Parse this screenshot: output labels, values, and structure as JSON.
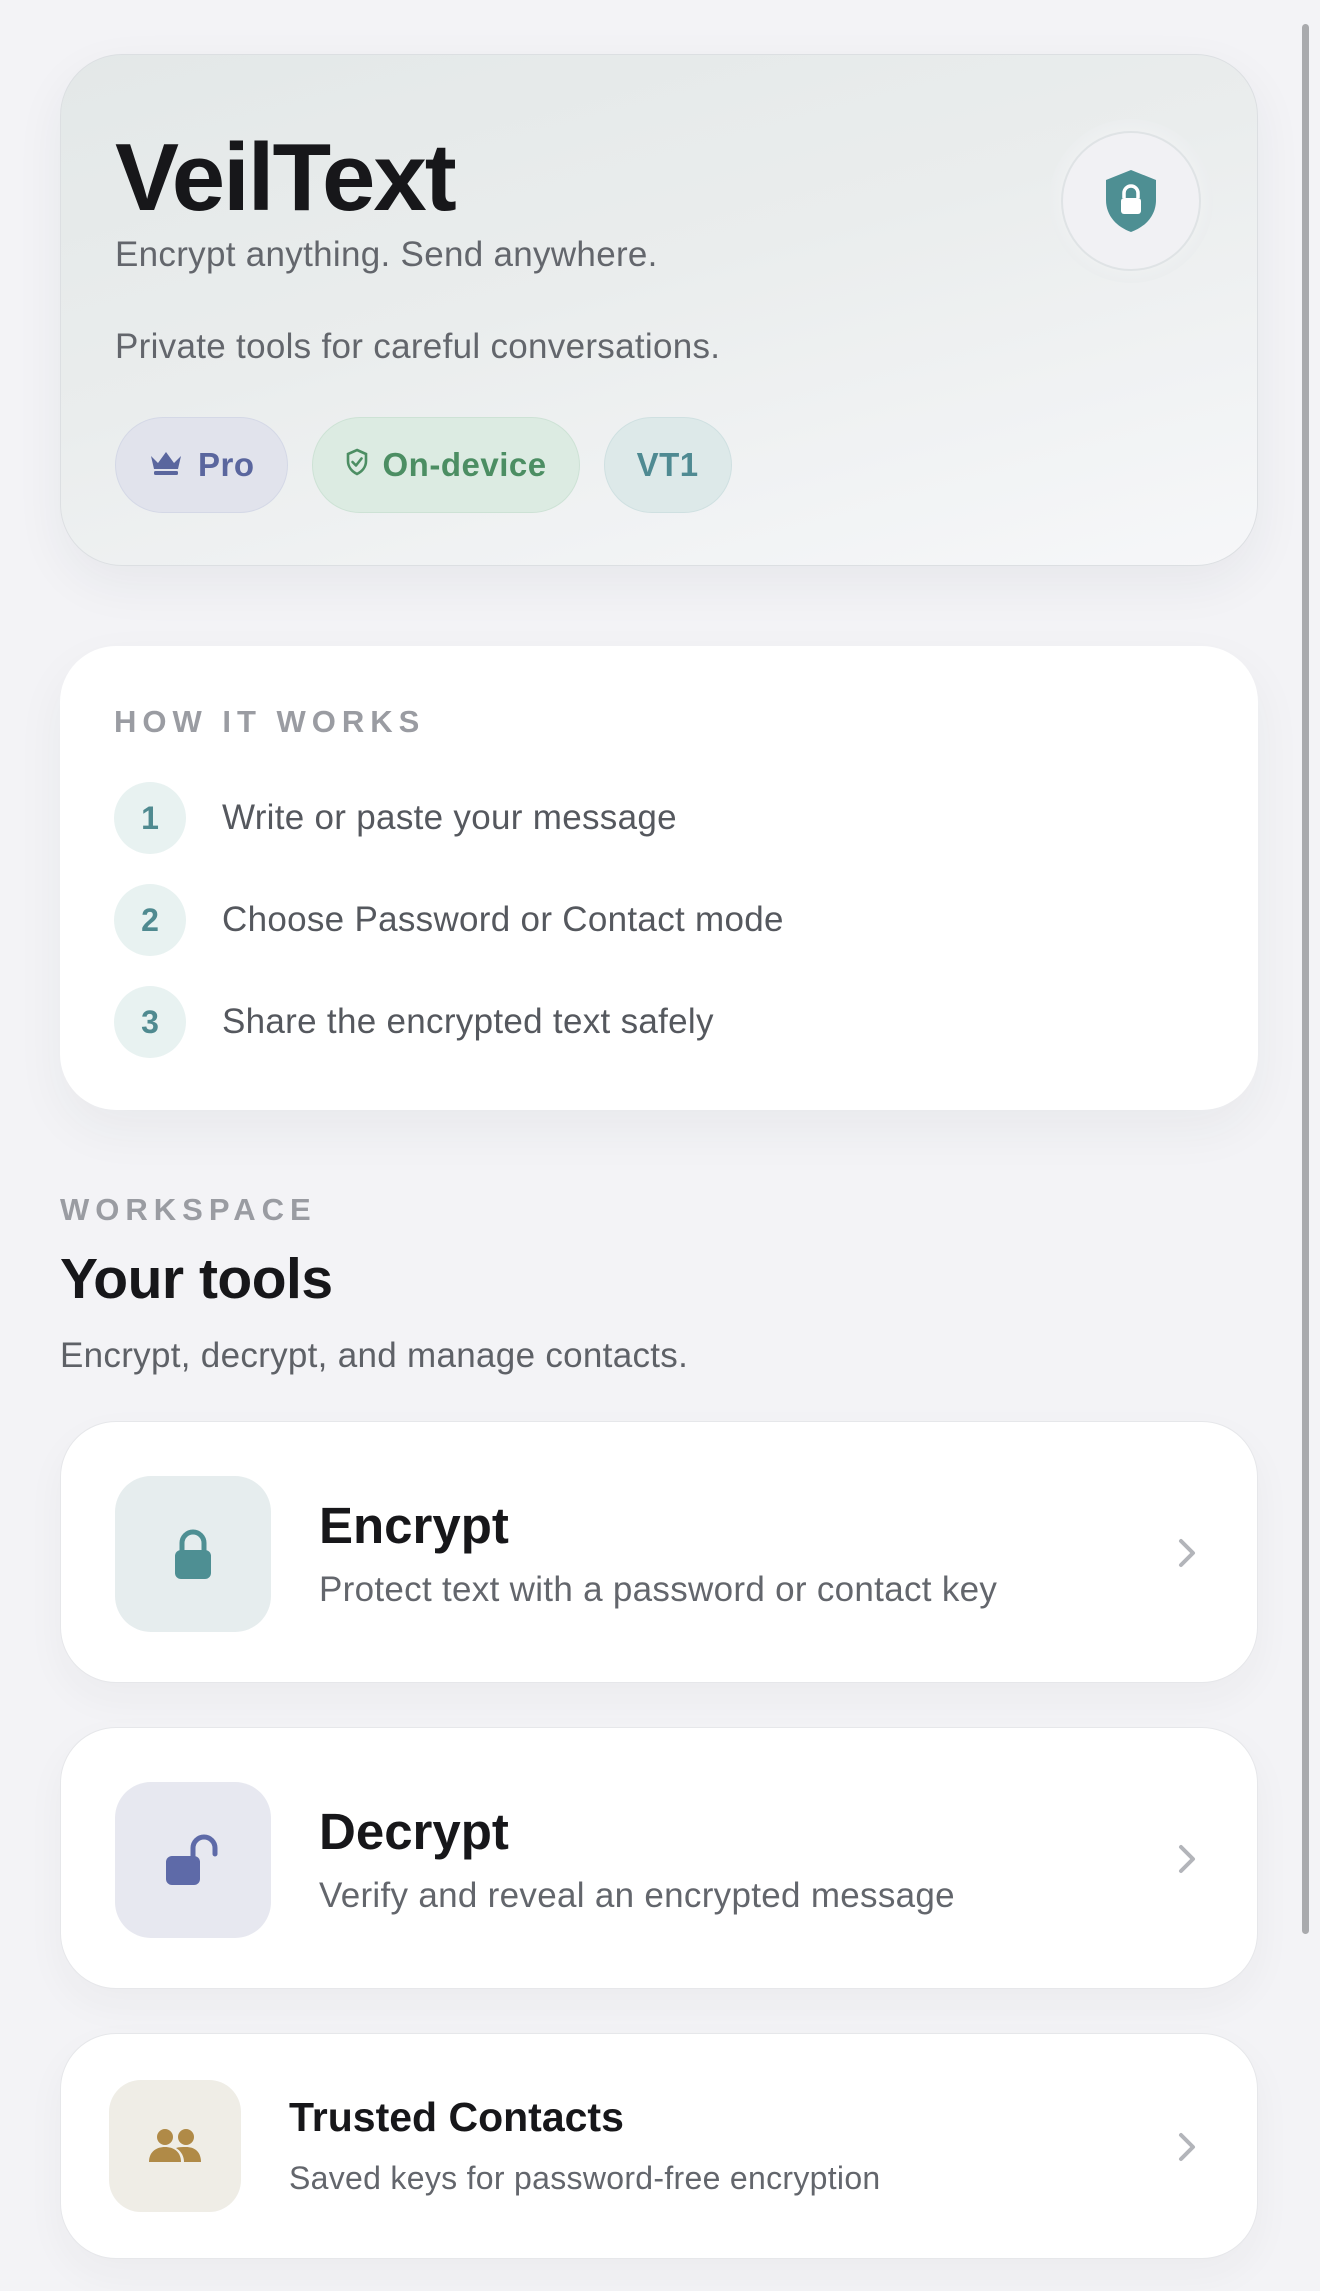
{
  "hero": {
    "title": "VeilText",
    "tagline": "Encrypt anything. Send anywhere.",
    "description": "Private tools for careful conversations.",
    "icon": "shield-lock-icon",
    "badges": [
      {
        "label": "Pro",
        "icon": "crown-icon",
        "color": "#5a669e"
      },
      {
        "label": "On-device",
        "icon": "shield-check-icon",
        "color": "#4c8e63"
      },
      {
        "label": "VT1",
        "color": "#4f8a92"
      }
    ]
  },
  "how_it_works": {
    "heading": "HOW IT WORKS",
    "steps": [
      {
        "number": "1",
        "text": "Write or paste your message"
      },
      {
        "number": "2",
        "text": "Choose Password or Contact mode"
      },
      {
        "number": "3",
        "text": "Share the encrypted text safely"
      }
    ]
  },
  "workspace": {
    "eyebrow": "WORKSPACE",
    "title": "Your tools",
    "subtitle": "Encrypt, decrypt, and manage contacts.",
    "tools": [
      {
        "title": "Encrypt",
        "description": "Protect text with a password or contact key",
        "icon": "lock-icon",
        "accent": "#4e8f93"
      },
      {
        "title": "Decrypt",
        "description": "Verify and reveal an encrypted message",
        "icon": "unlock-icon",
        "accent": "#5e6aa8"
      },
      {
        "title": "Trusted Contacts",
        "description": "Saved keys for password-free encryption",
        "icon": "people-icon",
        "accent": "#b08a47"
      }
    ]
  }
}
